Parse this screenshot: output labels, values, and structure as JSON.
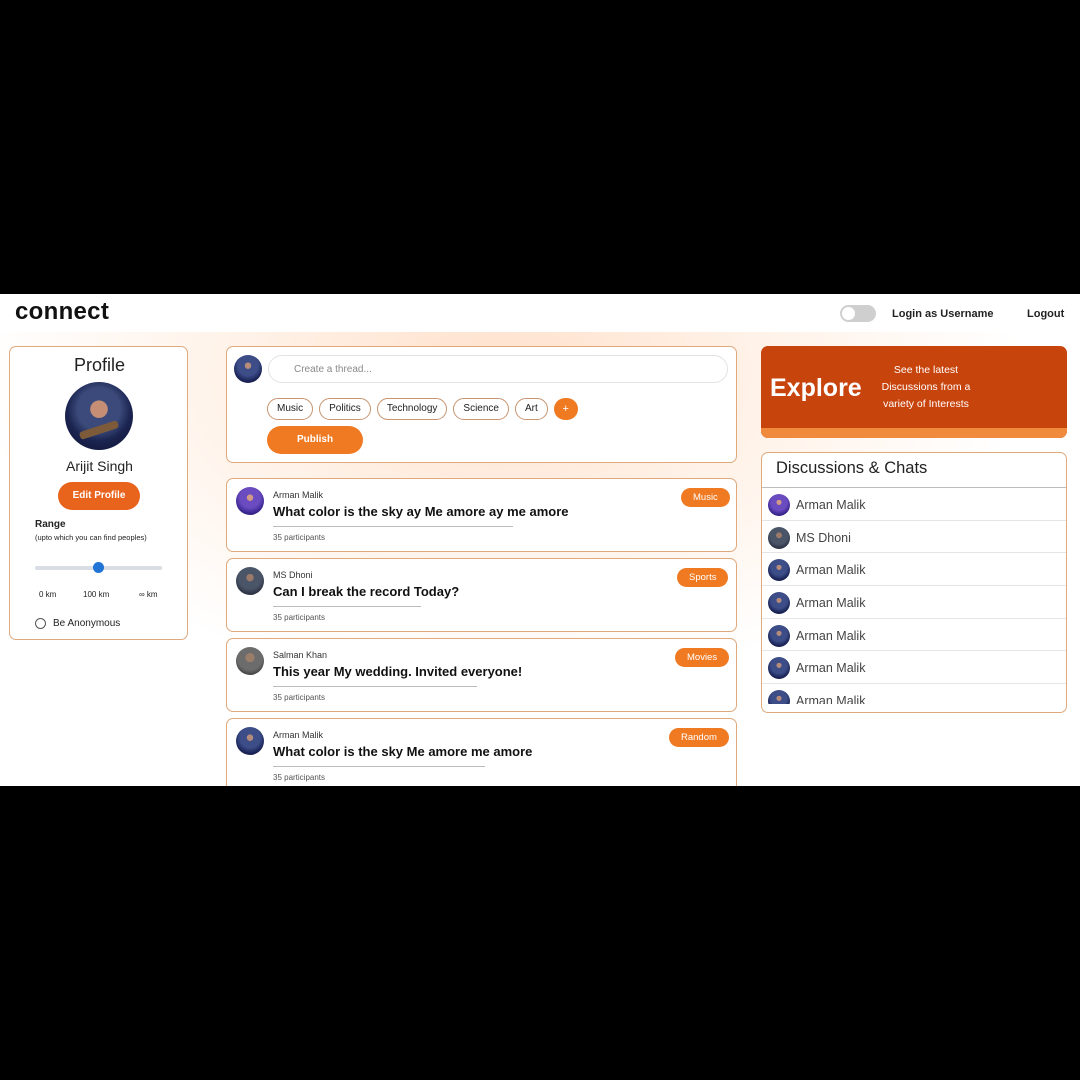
{
  "app": {
    "logo": "connect",
    "login_label": "Login as Username",
    "logout": "Logout"
  },
  "profile": {
    "title": "Profile",
    "name": "Arijit Singh",
    "edit_button": "Edit Profile",
    "range_label": "Range",
    "range_sub": "(upto which you can find peoples)",
    "range_value_km": 100,
    "ticks": [
      "0 km",
      "100 km",
      "∞ km"
    ],
    "anonymous_label": "Be Anonymous"
  },
  "composer": {
    "placeholder": "Create a thread...",
    "tags": [
      "Music",
      "Politics",
      "Technology",
      "Science",
      "Art"
    ],
    "add_tag": "+",
    "publish": "Publish"
  },
  "posts": [
    {
      "author": "Arman Malik",
      "title": "What color is the sky ay Me amore ay me amore",
      "participants": "35 participants",
      "badge": "Music"
    },
    {
      "author": "MS Dhoni",
      "title": "Can I break the record Today?",
      "participants": "35 participants",
      "badge": "Sports"
    },
    {
      "author": "Salman Khan",
      "title": "This year My wedding. Invited everyone!",
      "participants": "35 participants",
      "badge": "Movies"
    },
    {
      "author": "Arman Malik",
      "title": "What color is the sky Me amore me amore",
      "participants": "35 participants",
      "badge": "Random"
    }
  ],
  "explore": {
    "title": "Explore",
    "description": "See the latest Discussions from a variety of Interests"
  },
  "discussions": {
    "title": "Discussions & Chats",
    "items": [
      "Arman Malik",
      "MS Dhoni",
      "Arman Malik",
      "Arman Malik",
      "Arman Malik",
      "Arman Malik",
      "Arman Malik"
    ]
  },
  "colors": {
    "accent": "#f07a22",
    "explore_bg": "#c8440d",
    "slider": "#1f74d6"
  }
}
